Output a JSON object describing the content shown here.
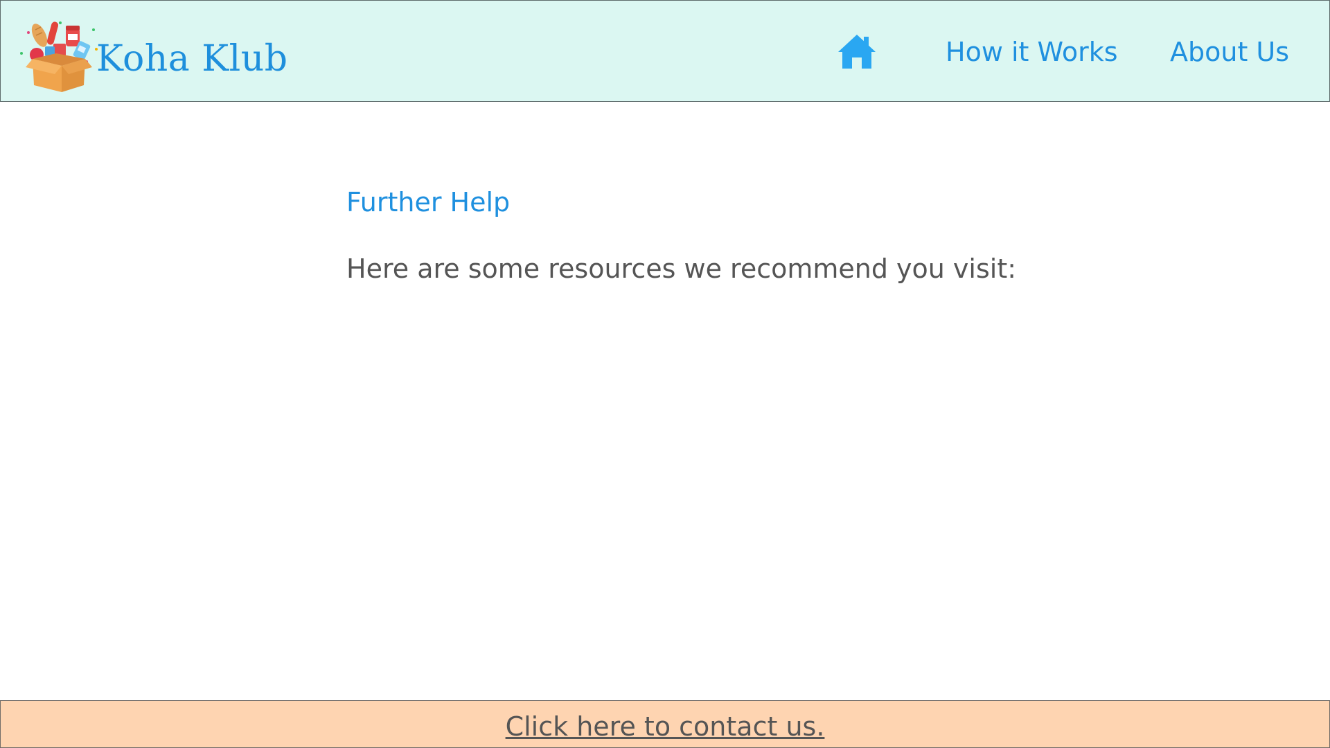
{
  "brand": {
    "name": "Koha Klub",
    "logo_icon": "grocery-box-icon"
  },
  "nav": {
    "home_icon": "home-icon",
    "how_it_works": "How it Works",
    "about_us": "About Us"
  },
  "main": {
    "section_title": "Further Help",
    "intro_text": "Here are some resources we recommend you visit:"
  },
  "footer": {
    "contact_link": "Click here to contact us."
  },
  "colors": {
    "header_bg": "#dbf7f2",
    "accent_blue": "#1f90df",
    "home_icon_blue": "#2aa7f2",
    "body_text": "#555555",
    "footer_bg": "#fed4b1"
  }
}
